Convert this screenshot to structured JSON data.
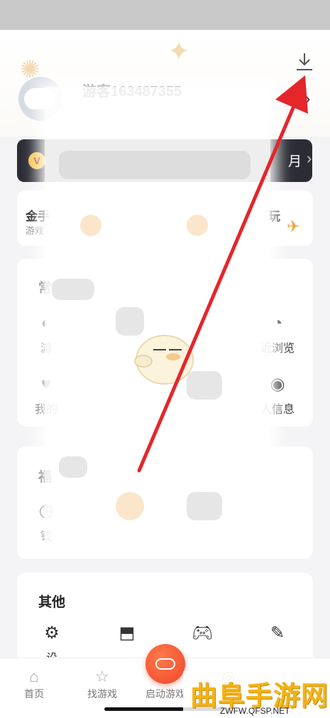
{
  "profile": {
    "username": "游客163487355"
  },
  "vip": {
    "text": "月"
  },
  "coins": {
    "label": "金手",
    "sub": "游戏",
    "right": "玩"
  },
  "common": {
    "title": "常",
    "items_row1": [
      {
        "label": "游",
        "icon": "game-icon"
      },
      {
        "label": "近浏览",
        "icon": "history-icon"
      }
    ],
    "items_row2": [
      {
        "label": "我的",
        "icon": "heart-icon"
      },
      {
        "label": "人信息",
        "icon": "user-icon"
      }
    ]
  },
  "welfare": {
    "title": "福",
    "items": [
      {
        "label": "钱",
        "icon": "clock-icon"
      }
    ]
  },
  "other": {
    "title": "其他",
    "items": [
      {
        "label": "设",
        "icon": "gear-icon"
      },
      {
        "label": "",
        "icon": "share-icon"
      },
      {
        "label": "",
        "icon": "gamepad-icon"
      },
      {
        "label": "",
        "icon": "feedback-icon"
      }
    ]
  },
  "tabbar": {
    "items": [
      {
        "label": "首页",
        "icon": "home-icon"
      },
      {
        "label": "找游戏",
        "icon": "star-icon"
      },
      {
        "label": "启动游戏",
        "icon": "launch-icon"
      }
    ]
  },
  "watermark": {
    "main": "曲阜手游网",
    "sub": "ZWFW.QFSP.NET"
  },
  "colors": {
    "arrow": "#e5262b",
    "accent": "#f0462a",
    "vip_bg": "#2b2c36"
  }
}
